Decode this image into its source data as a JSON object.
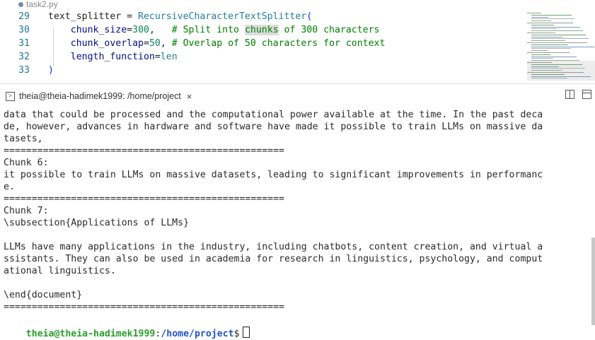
{
  "editor": {
    "tab_filename": "task2.py",
    "lines": [
      {
        "number": "29",
        "parts": [
          {
            "text": "text_splitter = ",
            "kind": "plain"
          },
          {
            "text": "RecursiveCharacterTextSplitter",
            "kind": "func"
          },
          {
            "text": "(",
            "kind": "punc"
          }
        ]
      },
      {
        "number": "30",
        "parts": [
          {
            "text": "    ",
            "kind": "plain"
          },
          {
            "text": "chunk_size",
            "kind": "param"
          },
          {
            "text": "=",
            "kind": "plain"
          },
          {
            "text": "300",
            "kind": "num"
          },
          {
            "text": ",   ",
            "kind": "plain"
          },
          {
            "text": "# Split into ",
            "kind": "cmt"
          },
          {
            "text": "chunks",
            "kind": "hl"
          },
          {
            "text": " of 300 characters",
            "kind": "cmt"
          }
        ]
      },
      {
        "number": "31",
        "parts": [
          {
            "text": "    ",
            "kind": "plain"
          },
          {
            "text": "chunk_overlap",
            "kind": "param"
          },
          {
            "text": "=",
            "kind": "plain"
          },
          {
            "text": "50",
            "kind": "num"
          },
          {
            "text": ", ",
            "kind": "plain"
          },
          {
            "text": "# Overlap of 50 characters for context",
            "kind": "cmt"
          }
        ]
      },
      {
        "number": "32",
        "parts": [
          {
            "text": "    ",
            "kind": "plain"
          },
          {
            "text": "length_function",
            "kind": "param"
          },
          {
            "text": "=",
            "kind": "plain"
          },
          {
            "text": "len",
            "kind": "func"
          }
        ]
      },
      {
        "number": "33",
        "parts": [
          {
            "text": ")",
            "kind": "punc"
          }
        ]
      }
    ]
  },
  "panel": {
    "terminal_tab_label": "theia@theia-hadimek1999: /home/project",
    "close_glyph": "×",
    "terminal_icon": "terminal-icon",
    "split_icon": "split-terminal-icon",
    "maximize_icon": "maximize-panel-icon"
  },
  "terminal": {
    "lines": [
      "data that could be processed and the computational power available at the time. In the past deca",
      "de, however, advances in hardware and software have made it possible to train LLMs on massive da",
      "tasets,",
      "==================================================",
      "Chunk 6:",
      "it possible to train LLMs on massive datasets, leading to significant improvements in performanc",
      "e.",
      "==================================================",
      "Chunk 7:",
      "\\subsection{Applications of LLMs}",
      "",
      "LLMs have many applications in the industry, including chatbots, content creation, and virtual a",
      "ssistants. They can also be used in academia for research in linguistics, psychology, and comput",
      "ational linguistics.",
      "",
      "\\end{document}",
      "=================================================="
    ],
    "prompt": {
      "user_host": "theia@theia-hadimek1999",
      "separator": ":",
      "path": "/home/project",
      "symbol": "$"
    }
  },
  "colors": {
    "line_number": "#237893",
    "comment": "#008000",
    "number": "#098658",
    "function": "#267f99",
    "prompt_user": "#2a9f2a",
    "prompt_path": "#2155c8"
  }
}
